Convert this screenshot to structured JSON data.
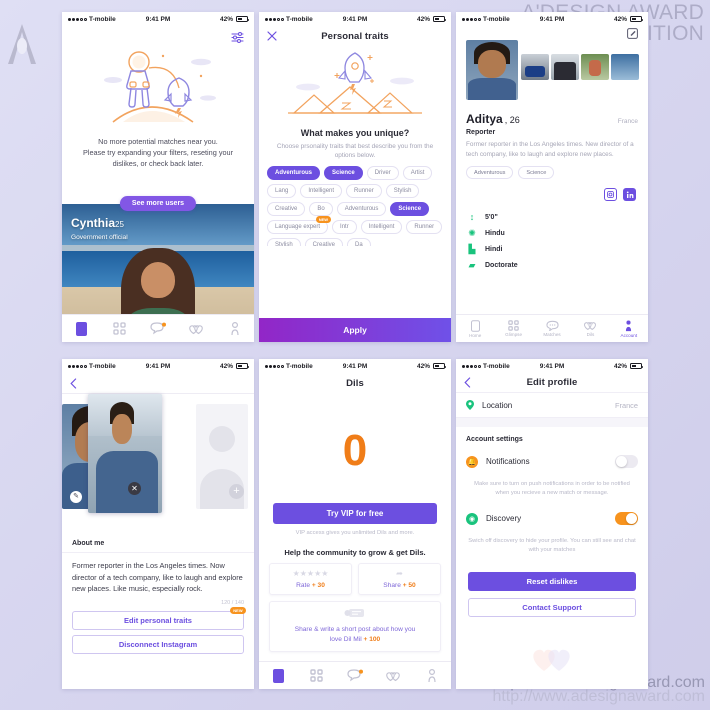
{
  "watermark": {
    "logo": "adesign-logo-icon",
    "title_line1": "A'DESIGN AWARD",
    "title_line2": "& COMPETITION",
    "url": "http://www.adesignaward.com",
    "url_shadow": "http://www.adesignaward.com"
  },
  "colors": {
    "brand_purple": "#6c4fe0",
    "accent_orange": "#f7931e",
    "accent_green": "#19c37d",
    "dils_orange": "#f07d18",
    "page_bg": "#d8d7f0"
  },
  "status_bar": {
    "carrier": "T-mobile",
    "time": "9:41 PM",
    "battery": "42%"
  },
  "tabbar": {
    "items": [
      {
        "label": "Home",
        "icon": "home-phone-icon",
        "active": true
      },
      {
        "label": "Glimpse",
        "icon": "grid-dots-icon",
        "active": false
      },
      {
        "label": "Matches",
        "icon": "chat-bubble-icon",
        "active": false,
        "badge": true
      },
      {
        "label": "Dils",
        "icon": "double-heart-icon",
        "active": false
      },
      {
        "label": "Account",
        "icon": "person-icon",
        "active": false
      }
    ],
    "labels_visible_on": "profile-screen"
  },
  "screen1": {
    "name": "no-matches-screen",
    "filters_icon": "sliders-filter-icon",
    "illustration": "astronaut-rocket-illustration",
    "empty_line1": "No more potential matches near you.",
    "empty_line2": "Please try expanding your filters, reseting your",
    "empty_line3": "dislikes, or check back later.",
    "see_more_button": "See more users",
    "card": {
      "name": "Cynthia",
      "age": "25",
      "occupation": "Government official",
      "photo": "woman-at-beach-photo"
    }
  },
  "screen2": {
    "name": "personal-traits-screen",
    "close_icon": "close-x-icon",
    "title": "Personal traits",
    "illustration": "rocket-mountains-illustration",
    "heading": "What makes you unique?",
    "subtitle_line1": "Choose prsonality traits that best describe you",
    "subtitle_line2": "from the options below.",
    "traits": [
      {
        "label": "Adventurous",
        "selected": true
      },
      {
        "label": "Science",
        "selected": true
      },
      {
        "label": "Driver",
        "selected": false
      },
      {
        "label": "Artist",
        "selected": false
      },
      {
        "label": "Lang",
        "selected": false
      },
      {
        "label": "Intelligent",
        "selected": false
      },
      {
        "label": "Runner",
        "selected": false
      },
      {
        "label": "Stylish",
        "selected": false
      },
      {
        "label": "Creative",
        "selected": false
      },
      {
        "label": "Bo",
        "selected": false
      },
      {
        "label": "Adventurous",
        "selected": false
      },
      {
        "label": "Science",
        "selected": true
      },
      {
        "label": "Language expert",
        "selected": false,
        "badge": "NEW"
      },
      {
        "label": "Intr",
        "selected": false
      },
      {
        "label": "Intelligent",
        "selected": false
      },
      {
        "label": "Runner",
        "selected": false
      },
      {
        "label": "Stylish",
        "selected": false
      },
      {
        "label": "Creative",
        "selected": false
      },
      {
        "label": "Da",
        "selected": false
      }
    ],
    "apply_button": "Apply"
  },
  "screen3": {
    "name": "Aditya",
    "edit_icon": "edit-square-icon",
    "avatar": "aditya-selfie-photo",
    "gallery": [
      "motorcycle-photo",
      "friends-group-photo",
      "child-photo",
      "portrait-photo"
    ],
    "age": "26",
    "location": "France",
    "occupation": "Reporter",
    "bio": "Former reporter in the Los Angeles times. New director of a tech company, like to laugh and explore new places.",
    "tags": [
      "Adventurous",
      "Science"
    ],
    "social": [
      {
        "name": "instagram-icon"
      },
      {
        "name": "linkedin-icon"
      }
    ],
    "facts": [
      {
        "icon": "height-ruler-icon",
        "value": "5'0\""
      },
      {
        "icon": "religion-icon",
        "value": "Hindu"
      },
      {
        "icon": "language-icon",
        "value": "Hindi"
      },
      {
        "icon": "education-icon",
        "value": "Doctorate"
      }
    ]
  },
  "screen4": {
    "name": "edit-about-me-screen",
    "back_icon": "chevron-left-icon",
    "photos": [
      "selfie-photo",
      "car-selfie-photo"
    ],
    "empty_photo_slot": "add-photo-placeholder",
    "delete_icon": "close-circle-icon",
    "edit_icon": "pencil-icon",
    "add_icon": "plus-icon",
    "about_heading": "About me",
    "about_text": "Former reporter in the Los Angeles times. Now director of a tech company, like to laugh and explore new places. Like music, especially rock.",
    "counter": "120 / 140",
    "edit_traits_button": "Edit personal traits",
    "edit_traits_badge": "NEW",
    "disconnect_button": "Disconnect Instagram"
  },
  "screen5": {
    "name": "dils-screen",
    "title": "Dils",
    "count": "0",
    "vip_button": "Try VIP for free",
    "vip_subtitle": "VIP access gives you unlimited Dils and more.",
    "help_heading": "Help the community to grow & get Dils.",
    "rewards": [
      {
        "icon": "stars-rating-icon",
        "label": "Rate ",
        "amount": "+ 30"
      },
      {
        "icon": "share-arrow-icon",
        "label": "Share ",
        "amount": "+ 50"
      }
    ],
    "wide_reward": {
      "icon": "post-message-icon",
      "label_line1": "Share & write a short post about how you",
      "label_line2": "love Dil Mil ",
      "amount": "+ 100"
    }
  },
  "screen6": {
    "name": "edit-profile-screen",
    "back_icon": "chevron-left-icon",
    "title": "Edit profile",
    "location_row": {
      "icon": "location-pin-icon",
      "label": "Location",
      "value": "France"
    },
    "section_heading": "Account settings",
    "settings": [
      {
        "icon": "bell-icon",
        "label": "Notifications",
        "toggle": "off",
        "help_line1": "Make sure to turn on push notifications in order to be",
        "help_line2": "notified when you recieve a new match or message."
      },
      {
        "icon": "discovery-search-icon",
        "label": "Discovery",
        "toggle": "on",
        "help_line1": "Swich off discovery to hide your profile. You can still",
        "help_line2": "see and chat with your matches"
      }
    ],
    "reset_button": "Reset dislikes",
    "support_button": "Contact Support",
    "footer_mark": "hearts-watermark"
  }
}
